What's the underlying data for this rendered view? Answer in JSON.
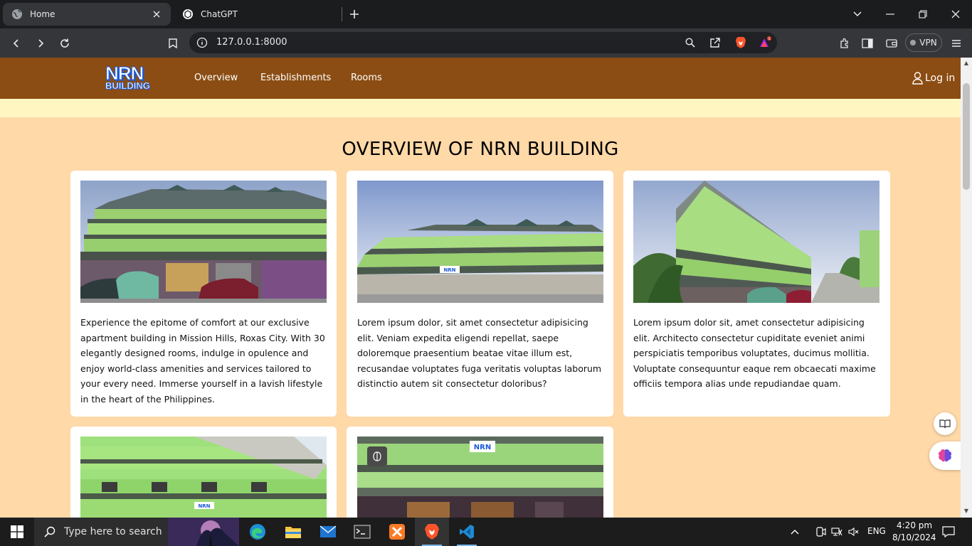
{
  "browser": {
    "tabs": [
      {
        "title": "Home",
        "active": true
      },
      {
        "title": "ChatGPT",
        "active": false
      }
    ],
    "url": "127.0.0.1:8000",
    "vpn_label": "VPN",
    "notification_badge": "1"
  },
  "site": {
    "logo_line1": "NRN",
    "logo_line2": "BUILDING",
    "nav": {
      "items": [
        {
          "label": "Overview"
        },
        {
          "label": "Establishments"
        },
        {
          "label": "Rooms"
        }
      ],
      "login_label": "Log in"
    },
    "heading": "OVERVIEW OF NRN BUILDING",
    "cards": [
      {
        "text": "Experience the epitome of comfort at our exclusive apartment building in Mission Hills, Roxas City. With 30 elegantly designed rooms, indulge in opulence and enjoy world-class amenities and services tailored to your every need. Immerse yourself in a lavish lifestyle in the heart of the Philippines."
      },
      {
        "text": "Lorem ipsum dolor, sit amet consectetur adipisicing elit. Veniam expedita eligendi repellat, saepe doloremque praesentium beatae vitae illum est, recusandae voluptates fuga veritatis voluptas laborum distinctio autem sit consectetur doloribus?"
      },
      {
        "text": "Lorem ipsum dolor sit, amet consectetur adipisicing elit. Architecto consectetur cupiditate eveniet animi perspiciatis temporibus voluptates, ducimus mollitia. Voluptate consequuntur eaque rem obcaecati maxime officiis tempora alias unde repudiandae quam."
      },
      {
        "text": ""
      },
      {
        "text": ""
      }
    ],
    "sign_text": "NRN"
  },
  "taskbar": {
    "search_placeholder": "Type here to search",
    "language": "ENG",
    "time": "4:20 pm",
    "date": "8/10/2024"
  },
  "colors": {
    "navbar": "#8b4d13",
    "page_bg": "#ffd9a8",
    "banner": "#fff6c2",
    "building_green": "#8fd27a"
  }
}
